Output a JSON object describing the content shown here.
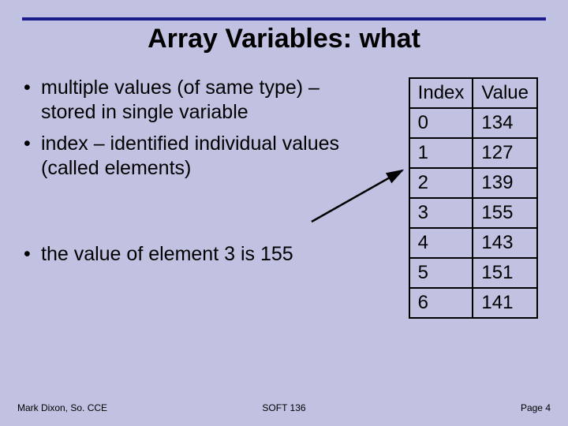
{
  "title": "Array Variables: what",
  "bullets": {
    "b1": "multiple values (of same type) – stored in single variable",
    "b2": "index – identified individual values (called elements)",
    "b3": "the value of element 3 is 155"
  },
  "table": {
    "h_index": "Index",
    "h_value": "Value",
    "rows": [
      {
        "i": "0",
        "v": "134"
      },
      {
        "i": "1",
        "v": "127"
      },
      {
        "i": "2",
        "v": "139"
      },
      {
        "i": "3",
        "v": "155"
      },
      {
        "i": "4",
        "v": "143"
      },
      {
        "i": "5",
        "v": "151"
      },
      {
        "i": "6",
        "v": "141"
      }
    ]
  },
  "footer": {
    "left": "Mark Dixon, So. CCE",
    "center": "SOFT 136",
    "right": "Page 4"
  }
}
